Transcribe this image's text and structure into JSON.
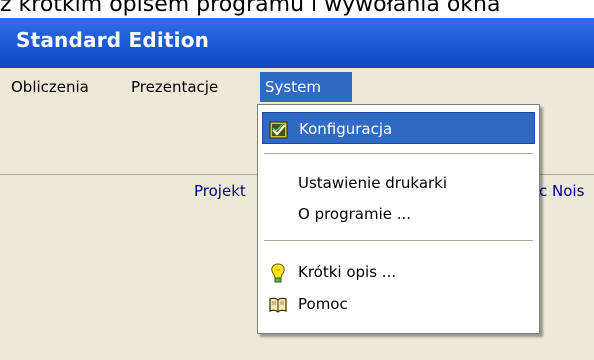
{
  "caption_text": "z krótkim opisem programu i wywołania okna",
  "window": {
    "title": "Standard Edition"
  },
  "menubar": {
    "items": [
      {
        "id": "obliczenia",
        "label": "Obliczenia"
      },
      {
        "id": "prezentacje",
        "label": "Prezentacje"
      },
      {
        "id": "system",
        "label": "System"
      }
    ]
  },
  "background": {
    "left_text": "Projekt",
    "right_text": "c Nois"
  },
  "dropdown": {
    "items": [
      {
        "id": "konfiguracja",
        "label": "Konfiguracja",
        "icon": "checklist-icon"
      },
      {
        "id": "ustawienie-drukarki",
        "label": "Ustawienie drukarki",
        "icon": ""
      },
      {
        "id": "o-programie",
        "label": "O programie ...",
        "icon": ""
      },
      {
        "id": "krotki-opis",
        "label": "Krótki opis ...",
        "icon": "lightbulb-icon"
      },
      {
        "id": "pomoc",
        "label": "Pomoc",
        "icon": "help-book-icon"
      }
    ]
  },
  "colors": {
    "title_bar": "#1d5ed8",
    "menu_highlight": "#316ac5",
    "menu_bg": "#ece9d8"
  }
}
